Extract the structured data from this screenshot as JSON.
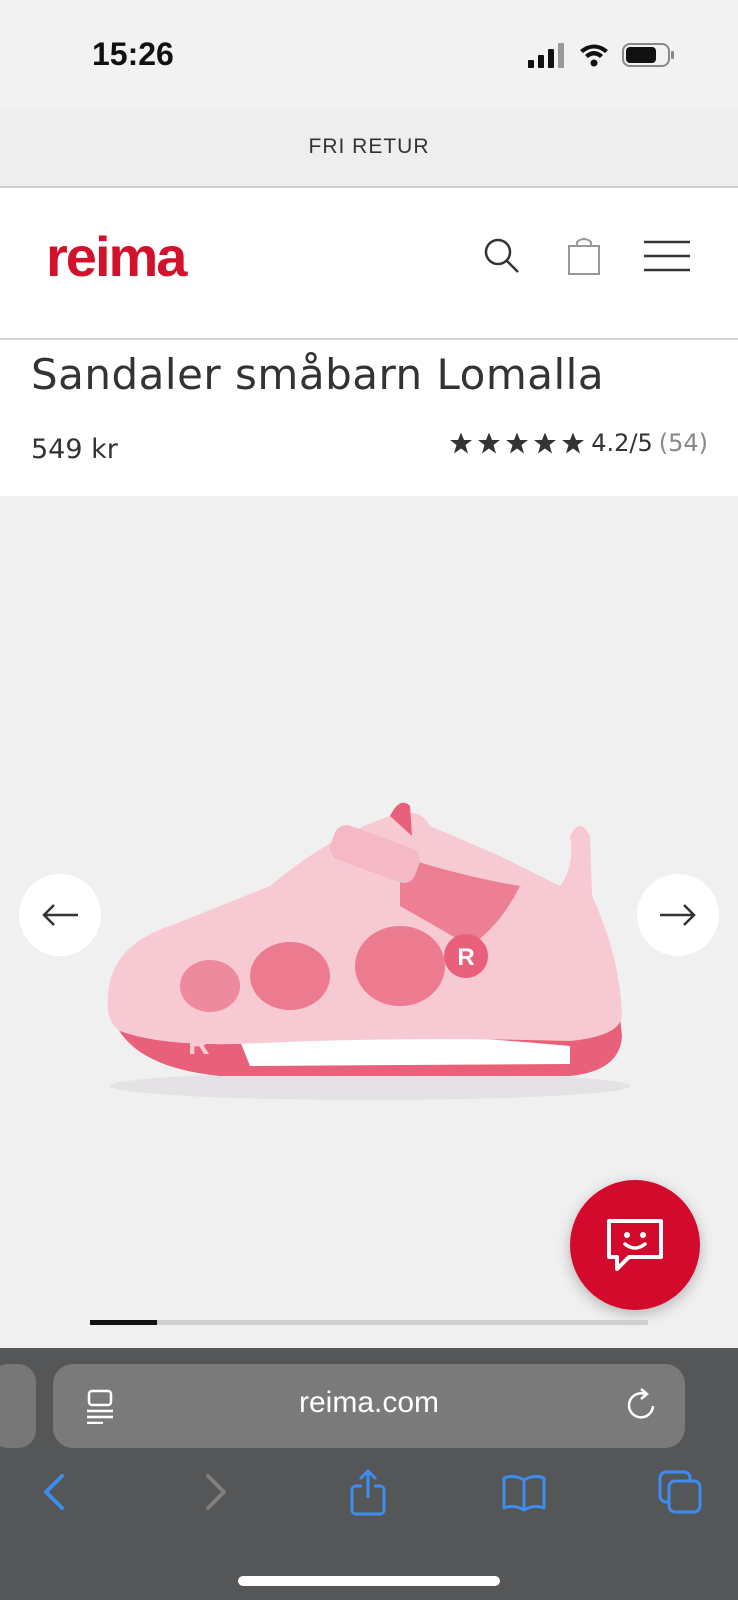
{
  "status": {
    "time": "15:26"
  },
  "promo": {
    "text": "FRI RETUR"
  },
  "header": {
    "logo": "reima",
    "icons": [
      "search-icon",
      "shopping-bag-icon",
      "menu-icon"
    ]
  },
  "product": {
    "title": "Sandaler småbarn Lomalla",
    "price": "549 kr",
    "rating_text": "4.2/5",
    "rating_count": "(54)",
    "rating_value": 4.2,
    "rating_max": 5
  },
  "gallery": {
    "progress_fraction": 0.12,
    "colors": {
      "brand": "#d3112c",
      "chat": "#d30a2c",
      "shoe_light": "#f7c9d3",
      "shoe_accent": "#e8607a"
    }
  },
  "browser": {
    "url": "reima.com",
    "toolbar_icons": [
      "back-icon",
      "forward-icon",
      "share-icon",
      "bookmarks-icon",
      "tabs-icon"
    ]
  }
}
